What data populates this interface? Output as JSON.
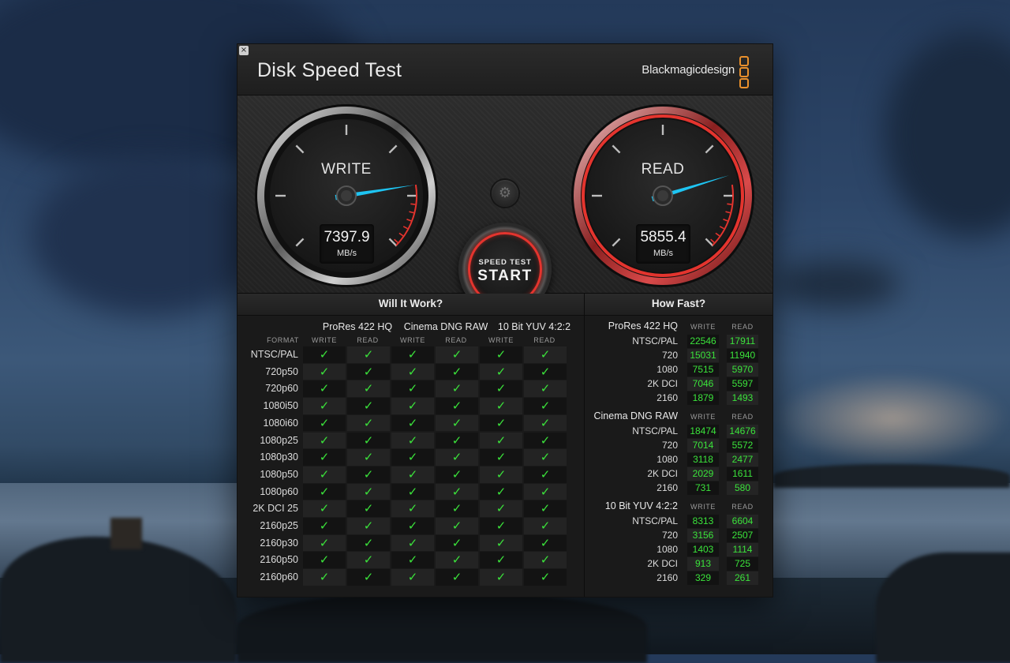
{
  "app": {
    "title": "Disk Speed Test",
    "brand": "Blackmagicdesign",
    "close_glyph": "×"
  },
  "gauges": {
    "write": {
      "label": "WRITE",
      "value": "7397.9",
      "unit": "MB/s",
      "needle_fraction": 0.8
    },
    "read": {
      "label": "READ",
      "value": "5855.4",
      "unit": "MB/s",
      "needle_fraction": 0.77
    }
  },
  "buttons": {
    "settings_icon": "⚙",
    "start_top": "SPEED TEST",
    "start_main": "START"
  },
  "will_it_work": {
    "title": "Will It Work?",
    "format_header": "FORMAT",
    "write_header": "WRITE",
    "read_header": "READ",
    "check": "✓",
    "codecs": [
      "ProRes 422 HQ",
      "Cinema DNG RAW",
      "10 Bit YUV 4:2:2"
    ],
    "formats": [
      "NTSC/PAL",
      "720p50",
      "720p60",
      "1080i50",
      "1080i60",
      "1080p25",
      "1080p30",
      "1080p50",
      "1080p60",
      "2K DCI 25",
      "2160p25",
      "2160p30",
      "2160p50",
      "2160p60"
    ]
  },
  "how_fast": {
    "title": "How Fast?",
    "write_header": "WRITE",
    "read_header": "READ",
    "groups": [
      {
        "codec": "ProRes 422 HQ",
        "rows": [
          {
            "format": "NTSC/PAL",
            "write": "22546",
            "read": "17911"
          },
          {
            "format": "720",
            "write": "15031",
            "read": "11940"
          },
          {
            "format": "1080",
            "write": "7515",
            "read": "5970"
          },
          {
            "format": "2K DCI",
            "write": "7046",
            "read": "5597"
          },
          {
            "format": "2160",
            "write": "1879",
            "read": "1493"
          }
        ]
      },
      {
        "codec": "Cinema DNG RAW",
        "rows": [
          {
            "format": "NTSC/PAL",
            "write": "18474",
            "read": "14676"
          },
          {
            "format": "720",
            "write": "7014",
            "read": "5572"
          },
          {
            "format": "1080",
            "write": "3118",
            "read": "2477"
          },
          {
            "format": "2K DCI",
            "write": "2029",
            "read": "1611"
          },
          {
            "format": "2160",
            "write": "731",
            "read": "580"
          }
        ]
      },
      {
        "codec": "10 Bit YUV 4:2:2",
        "rows": [
          {
            "format": "NTSC/PAL",
            "write": "8313",
            "read": "6604"
          },
          {
            "format": "720",
            "write": "3156",
            "read": "2507"
          },
          {
            "format": "1080",
            "write": "1403",
            "read": "1114"
          },
          {
            "format": "2K DCI",
            "write": "913",
            "read": "725"
          },
          {
            "format": "2160",
            "write": "329",
            "read": "261"
          }
        ]
      }
    ]
  },
  "colors": {
    "check_green": "#3be33b",
    "needle_blue": "#1ec4f2",
    "accent_red": "#e4342e",
    "brand_orange": "#e9902c"
  }
}
